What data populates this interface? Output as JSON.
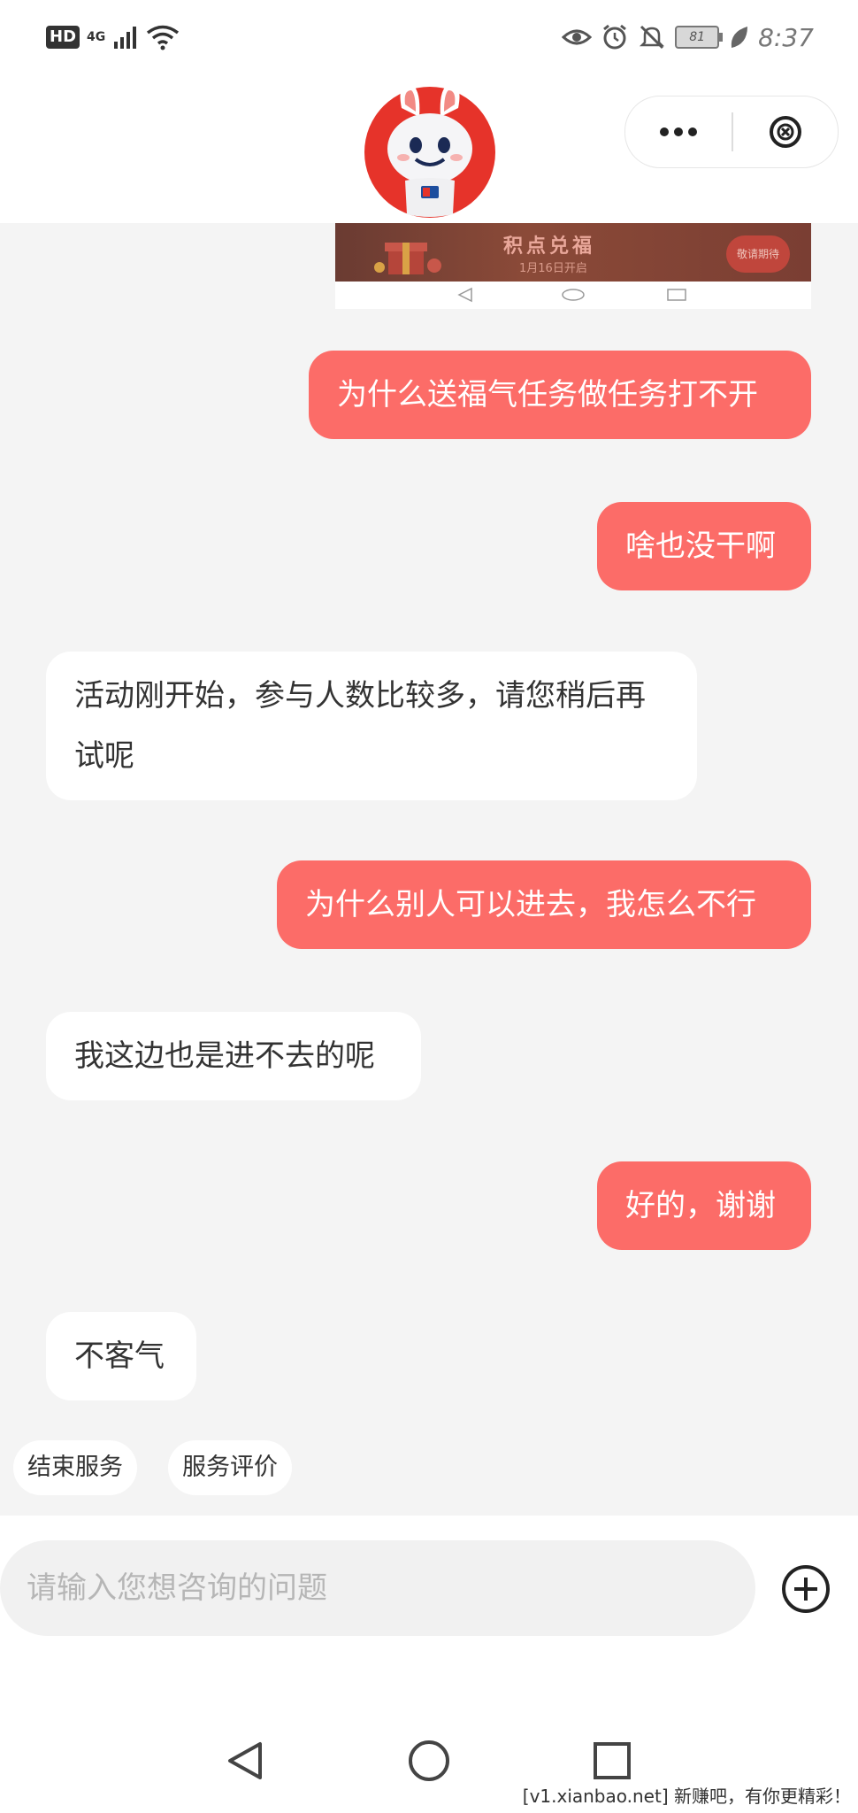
{
  "status_bar": {
    "hd": "HD",
    "network": "4G",
    "battery": "81",
    "time": "8:37",
    "icons": [
      "signal-icon",
      "wifi-icon",
      "eye-icon",
      "alarm-icon",
      "mute-icon",
      "battery-icon",
      "leaf-icon"
    ]
  },
  "header": {
    "mascot": "mascot-avatar",
    "more_icon": "more-icon",
    "close_icon": "close-icon"
  },
  "shared_screenshot": {
    "banner_title": "积点兑福",
    "banner_subtitle": "1月16日开启",
    "banner_button": "敬请期待"
  },
  "messages": [
    {
      "role": "user",
      "text": "为什么送福气任务做任务打不开"
    },
    {
      "role": "user",
      "text": "啥也没干啊"
    },
    {
      "role": "bot",
      "text": "活动刚开始，参与人数比较多，请您稍后再试呢"
    },
    {
      "role": "user",
      "text": "为什么别人可以进去，我怎么不行"
    },
    {
      "role": "bot",
      "text": "我这边也是进不去的呢"
    },
    {
      "role": "user",
      "text": "好的，谢谢"
    },
    {
      "role": "bot",
      "text": "不客气"
    }
  ],
  "quick_actions": [
    "结束服务",
    "服务评价"
  ],
  "input": {
    "value": "",
    "placeholder": "请输入您想咨询的问题",
    "plus_icon": "plus-circle-icon"
  },
  "nav_bar": {
    "icons": [
      "back-icon",
      "home-icon",
      "recents-icon"
    ]
  },
  "watermark": "[v1.xianbao.net] 新赚吧，有你更精彩！",
  "colors": {
    "user_bubble": "#fc6c68",
    "bot_bubble": "#ffffff",
    "chat_background": "#f4f4f4"
  }
}
